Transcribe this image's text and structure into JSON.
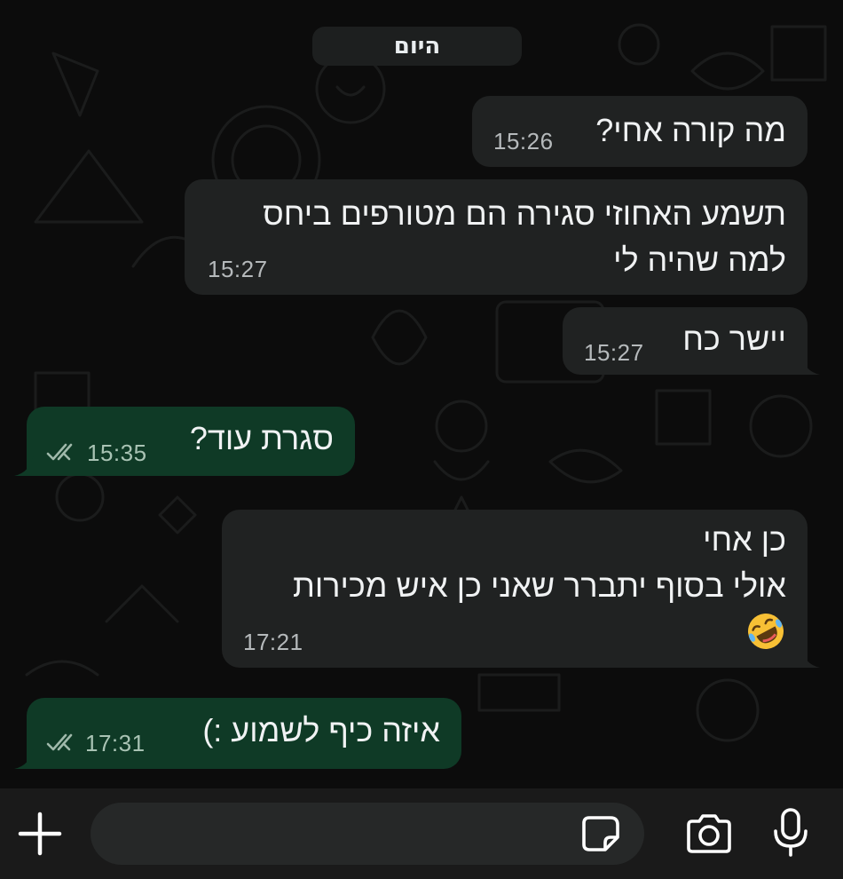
{
  "chat": {
    "date_label": "היום",
    "messages": [
      {
        "direction": "incoming",
        "lines": [
          "מה קורה אחי?"
        ],
        "time": "15:26"
      },
      {
        "direction": "incoming",
        "lines": [
          "תשמע האחוזי סגירה הם מטורפים ביחס",
          "למה שהיה לי"
        ],
        "time": "15:27"
      },
      {
        "direction": "incoming",
        "lines": [
          "יישר כח"
        ],
        "time": "15:27"
      },
      {
        "direction": "outgoing",
        "lines": [
          "סגרת עוד?"
        ],
        "time": "15:35",
        "status": "read-double-check-icon"
      },
      {
        "direction": "incoming",
        "lines": [
          "כן אחי",
          "אולי בסוף יתברר שאני כן איש מכירות"
        ],
        "emoji": "rolling-on-floor-laughing-emoji",
        "time": "17:21"
      },
      {
        "direction": "outgoing",
        "lines": [
          "איזה כיף לשמוע :)"
        ],
        "time": "17:31",
        "status": "read-double-check-icon"
      }
    ]
  },
  "composer": {
    "input_placeholder": "",
    "icons": [
      "plus-icon",
      "sticker-icon",
      "camera-icon",
      "microphone-icon"
    ]
  },
  "colors": {
    "background": "#0c0c0c",
    "incoming_bubble": "#202222",
    "outgoing_bubble": "#0f3a26",
    "composer_bar": "#1a1a1a"
  }
}
